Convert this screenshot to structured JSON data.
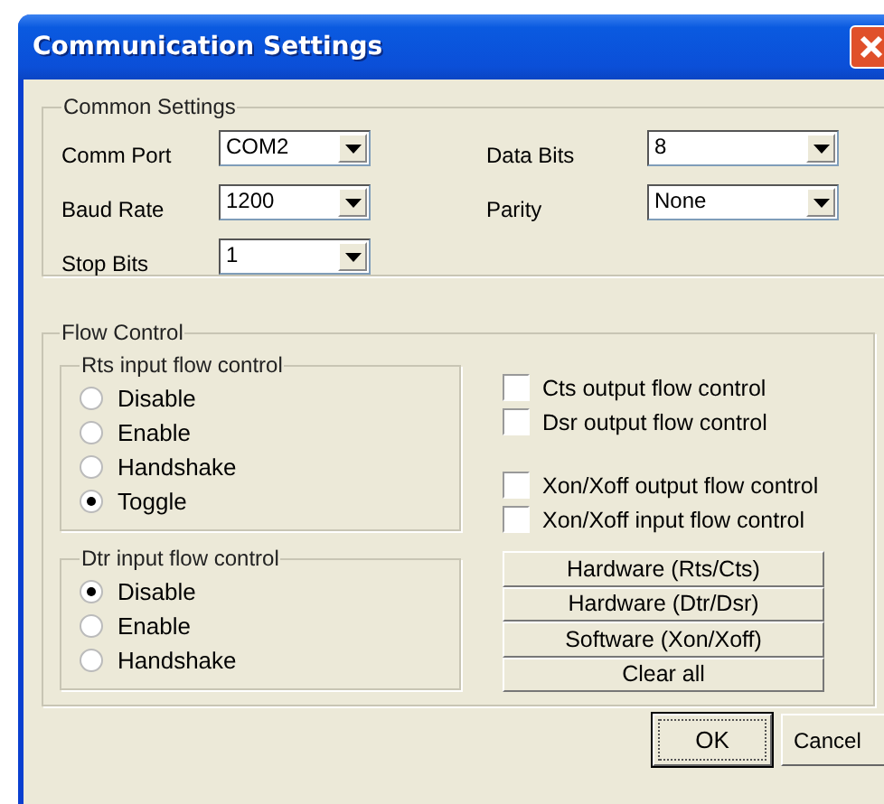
{
  "window": {
    "title": "Communication Settings"
  },
  "common_settings": {
    "title": "Common Settings",
    "fields": [
      {
        "label": "Comm Port",
        "value": "COM2"
      },
      {
        "label": "Data Bits",
        "value": "8"
      },
      {
        "label": "Baud Rate",
        "value": "1200"
      },
      {
        "label": "Parity",
        "value": "None"
      },
      {
        "label": "Stop Bits",
        "value": "1"
      }
    ]
  },
  "flow_control": {
    "title": "Flow Control",
    "groups": [
      {
        "title": "Rts input flow control",
        "options": [
          {
            "label": "Disable",
            "selected": false
          },
          {
            "label": "Enable",
            "selected": false
          },
          {
            "label": "Handshake",
            "selected": false
          },
          {
            "label": "Toggle",
            "selected": true
          }
        ]
      },
      {
        "title": "Dtr input flow control",
        "options": [
          {
            "label": "Disable",
            "selected": true
          },
          {
            "label": "Enable",
            "selected": false
          },
          {
            "label": "Handshake",
            "selected": false
          }
        ]
      }
    ],
    "checkboxes": [
      {
        "label": "Cts output flow control",
        "checked": false
      },
      {
        "label": "Dsr output flow control",
        "checked": false
      },
      {
        "label": "Xon/Xoff output flow control",
        "checked": false
      },
      {
        "label": "Xon/Xoff input flow control",
        "checked": false
      }
    ],
    "presets": [
      "Hardware (Rts/Cts)",
      "Hardware (Dtr/Dsr)",
      "Software (Xon/Xoff)",
      "Clear all"
    ]
  },
  "buttons": [
    {
      "label": "OK",
      "kind": "default"
    },
    {
      "label": "Cancel",
      "kind": "normal"
    }
  ]
}
